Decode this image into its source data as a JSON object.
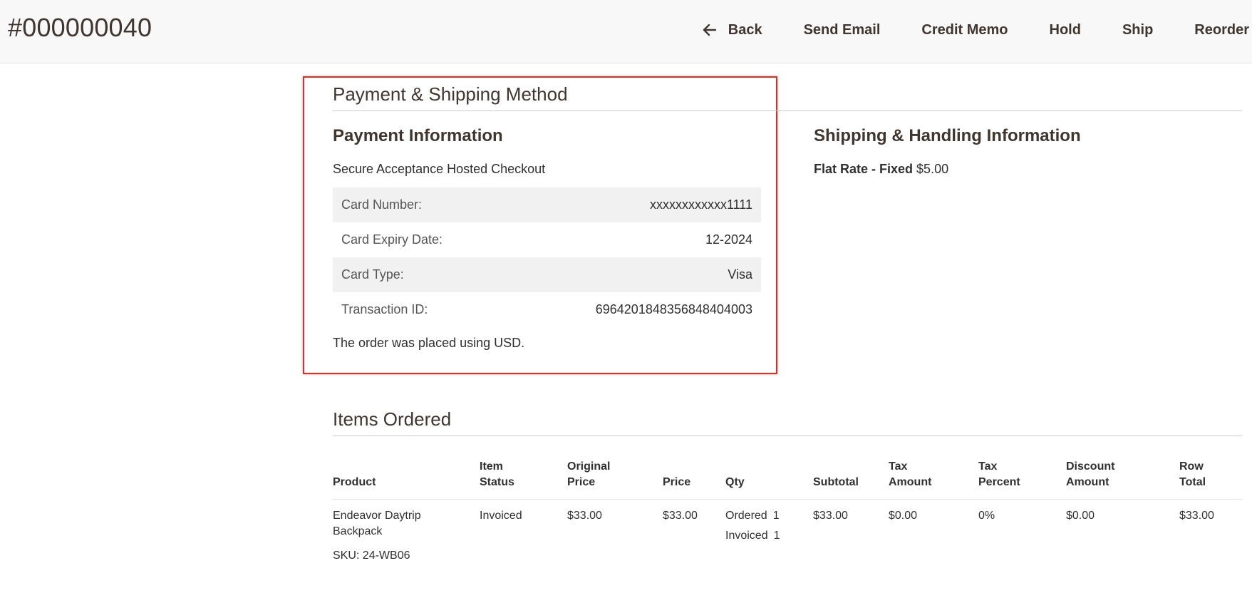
{
  "header": {
    "order_number": "#000000040",
    "actions": [
      {
        "label": "Back",
        "icon": "arrow-left-icon"
      },
      {
        "label": "Send Email"
      },
      {
        "label": "Credit Memo"
      },
      {
        "label": "Hold"
      },
      {
        "label": "Ship"
      },
      {
        "label": "Reorder"
      }
    ]
  },
  "payment_shipping": {
    "section_title": "Payment & Shipping Method",
    "payment": {
      "title": "Payment Information",
      "method": "Secure Acceptance Hosted Checkout",
      "rows": [
        {
          "label": "Card Number:",
          "value": "xxxxxxxxxxxx1111"
        },
        {
          "label": "Card Expiry Date:",
          "value": "12-2024"
        },
        {
          "label": "Card Type:",
          "value": "Visa"
        },
        {
          "label": "Transaction ID:",
          "value": "6964201848356848404003"
        }
      ],
      "currency_note": "The order was placed using USD."
    },
    "shipping": {
      "title": "Shipping & Handling Information",
      "method": "Flat Rate - Fixed",
      "price": "$5.00"
    }
  },
  "items": {
    "section_title": "Items Ordered",
    "columns": [
      [
        "",
        "Product"
      ],
      [
        "Item",
        "Status"
      ],
      [
        "Original",
        "Price"
      ],
      [
        "",
        "Price"
      ],
      [
        "",
        "Qty"
      ],
      [
        "",
        "Subtotal"
      ],
      [
        "Tax",
        "Amount"
      ],
      [
        "Tax",
        "Percent"
      ],
      [
        "Discount",
        "Amount"
      ],
      [
        "Row",
        "Total"
      ]
    ],
    "rows": [
      {
        "product_name": "Endeavor Daytrip Backpack",
        "sku": "SKU: 24-WB06",
        "status": "Invoiced",
        "original_price": "$33.00",
        "price": "$33.00",
        "qty": [
          {
            "label": "Ordered",
            "value": "1"
          },
          {
            "label": "Invoiced",
            "value": "1"
          }
        ],
        "subtotal": "$33.00",
        "tax_amount": "$0.00",
        "tax_percent": "0%",
        "discount_amount": "$0.00",
        "row_total": "$33.00"
      }
    ]
  },
  "colors": {
    "highlight_border": "#e02b27",
    "header_bg": "#f8f8f8",
    "stripe_bg": "#f1f1f1",
    "title_text": "#41362f"
  }
}
